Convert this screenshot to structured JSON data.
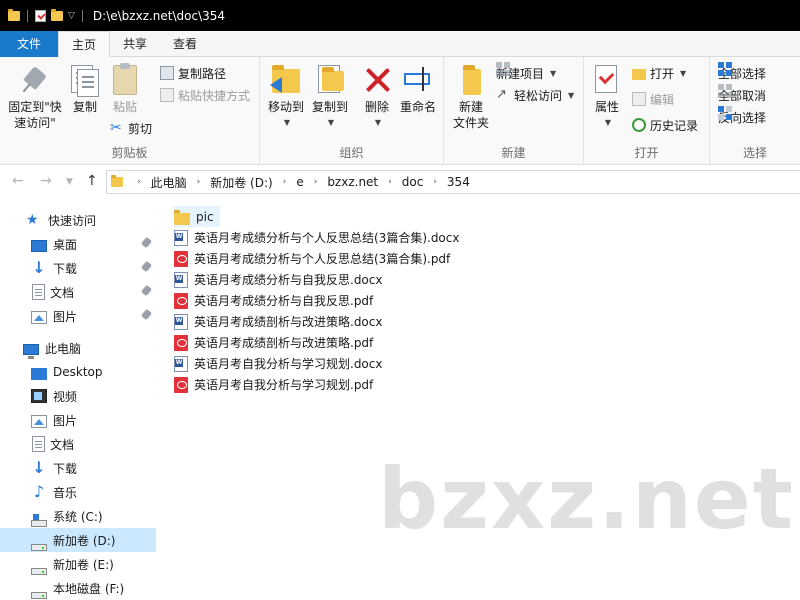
{
  "window": {
    "title_path": "D:\\e\\bzxz.net\\doc\\354"
  },
  "ribbon_tabs": [
    {
      "label": "文件"
    },
    {
      "label": "主页"
    },
    {
      "label": "共享"
    },
    {
      "label": "查看"
    }
  ],
  "ribbon": {
    "clipboard": {
      "label": "剪贴板",
      "pin": "固定到\"快速访问\"",
      "pin_line1": "固定到\"快",
      "pin_line2": "速访问\"",
      "copy": "复制",
      "paste": "粘贴",
      "copy_path": "复制路径",
      "paste_shortcut": "粘贴快捷方式",
      "cut": "剪切"
    },
    "organize": {
      "label": "组织",
      "move_to": "移动到",
      "copy_to": "复制到",
      "delete": "删除",
      "rename": "重命名"
    },
    "new": {
      "label": "新建",
      "new_folder_line1": "新建",
      "new_folder_line2": "文件夹",
      "new_item": "新建项目",
      "easy_access": "轻松访问"
    },
    "open": {
      "label": "打开",
      "properties": "属性",
      "open": "打开",
      "edit": "编辑",
      "history": "历史记录"
    },
    "select": {
      "label": "选择",
      "select_all": "全部选择",
      "select_none": "全部取消",
      "invert": "反向选择"
    }
  },
  "address": {
    "crumbs": [
      "此电脑",
      "新加卷 (D:)",
      "e",
      "bzxz.net",
      "doc",
      "354"
    ]
  },
  "sidebar": {
    "quick_access": "快速访问",
    "quick_items": [
      "桌面",
      "下载",
      "文档",
      "图片"
    ],
    "this_pc": "此电脑",
    "pc_items": [
      "Desktop",
      "视频",
      "图片",
      "文档",
      "下载",
      "音乐",
      "系统 (C:)",
      "新加卷 (D:)",
      "新加卷 (E:)",
      "本地磁盘 (F:)"
    ]
  },
  "files": [
    {
      "name": "pic",
      "type": "folder"
    },
    {
      "name": "英语月考成绩分析与个人反思总结(3篇合集).docx",
      "type": "docx"
    },
    {
      "name": "英语月考成绩分析与个人反思总结(3篇合集).pdf",
      "type": "pdf"
    },
    {
      "name": "英语月考成绩分析与自我反思.docx",
      "type": "docx"
    },
    {
      "name": "英语月考成绩分析与自我反思.pdf",
      "type": "pdf"
    },
    {
      "name": "英语月考成绩剖析与改进策略.docx",
      "type": "docx"
    },
    {
      "name": "英语月考成绩剖析与改进策略.pdf",
      "type": "pdf"
    },
    {
      "name": "英语月考自我分析与学习规划.docx",
      "type": "docx"
    },
    {
      "name": "英语月考自我分析与学习规划.pdf",
      "type": "pdf"
    }
  ],
  "watermark": "bzxz.net",
  "colors": {
    "accent": "#1979ca",
    "selection": "#cce8ff",
    "folder": "#f4c84c",
    "pdf": "#e2323a",
    "titlebar": "#000000"
  }
}
